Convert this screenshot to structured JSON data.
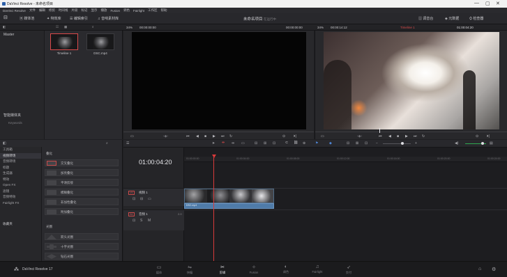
{
  "window": {
    "title": "DaVinci Resolve - 未命名项目",
    "controls": [
      "—",
      "▢",
      "✕"
    ]
  },
  "menu": [
    "DaVinci Resolve",
    "文件",
    "编辑",
    "修剪",
    "时间线",
    "片段",
    "标记",
    "显示",
    "播放",
    "Fusion",
    "调色",
    "Fairlight",
    "工作区",
    "帮助"
  ],
  "toolbar": {
    "left": [
      "媒体池",
      "特效库",
      "编辑索引",
      "音响素材库"
    ],
    "project": "未命名项目",
    "project_suffix": "在运行中",
    "right": [
      "调音台",
      "元数据",
      "检查器"
    ]
  },
  "subbar": {
    "zoom_left": "34%",
    "timecode_left": "00:00:00:00",
    "timecode_mid": "00:00:00:00",
    "zoom_right": "34%",
    "timecode_right": "00:00:14:12",
    "timeline_name": "Timeline 1",
    "timecode_end": "01:00:04:20"
  },
  "mediapool": {
    "bins": [
      "Master"
    ],
    "clips": [
      {
        "label": "Timeline 1"
      },
      {
        "label": "DSC.mp4"
      }
    ],
    "smart_bins_title": "智能媒体夹",
    "smart_bins_item": "Keywords"
  },
  "effects": {
    "tree": [
      {
        "label": "工具箱",
        "active": false
      },
      {
        "label": "视频转场",
        "active": true
      },
      {
        "label": "音频转场",
        "active": false
      },
      {
        "label": "标题",
        "active": false
      },
      {
        "label": "生成器",
        "active": false
      },
      {
        "label": "特效",
        "active": false
      },
      {
        "label": "Open FX",
        "active": false
      },
      {
        "label": "滤镜",
        "active": false
      },
      {
        "label": "音频特效",
        "active": false
      },
      {
        "label": "Fairlight FX",
        "active": false
      }
    ],
    "favorites": "收藏夹",
    "section_title": "叠化",
    "items": [
      "交叉叠化",
      "加亮叠化",
      "平滑剪接",
      "模糊叠化",
      "非加性叠化",
      "附加叠化"
    ],
    "section2_title": "光圈",
    "items2": [
      "箭头光圈",
      "十字光圈",
      "钻石光圈"
    ]
  },
  "timeline": {
    "timecode": "01:00:04:20",
    "tracks": [
      {
        "tag": "V1",
        "name": "视频 1",
        "count": ""
      },
      {
        "tag": "A1",
        "name": "音频 1",
        "count": "2.0"
      }
    ],
    "audio_clip_label": "DSC.mp4",
    "ruler": [
      "01:00:00:00",
      "01:00:04:00",
      "01:00:08:00",
      "01:00:12:00",
      "01:00:16:00",
      "01:00:20:00",
      "01:00:24:00"
    ]
  },
  "pages": [
    {
      "label": "媒体",
      "icon": "▭",
      "active": false
    },
    {
      "label": "快编",
      "icon": "⇋",
      "active": false
    },
    {
      "label": "剪辑",
      "icon": "✂",
      "active": true
    },
    {
      "label": "Fusion",
      "icon": "✧",
      "active": false
    },
    {
      "label": "调色",
      "icon": "◐",
      "active": false
    },
    {
      "label": "Fairlight",
      "icon": "♫",
      "active": false
    },
    {
      "label": "交付",
      "icon": "➶",
      "active": false
    }
  ],
  "brand": "DaVinci Resolve 17",
  "colors": {
    "accent": "#d83a3a",
    "clip_audio": "#4f7ba8"
  }
}
